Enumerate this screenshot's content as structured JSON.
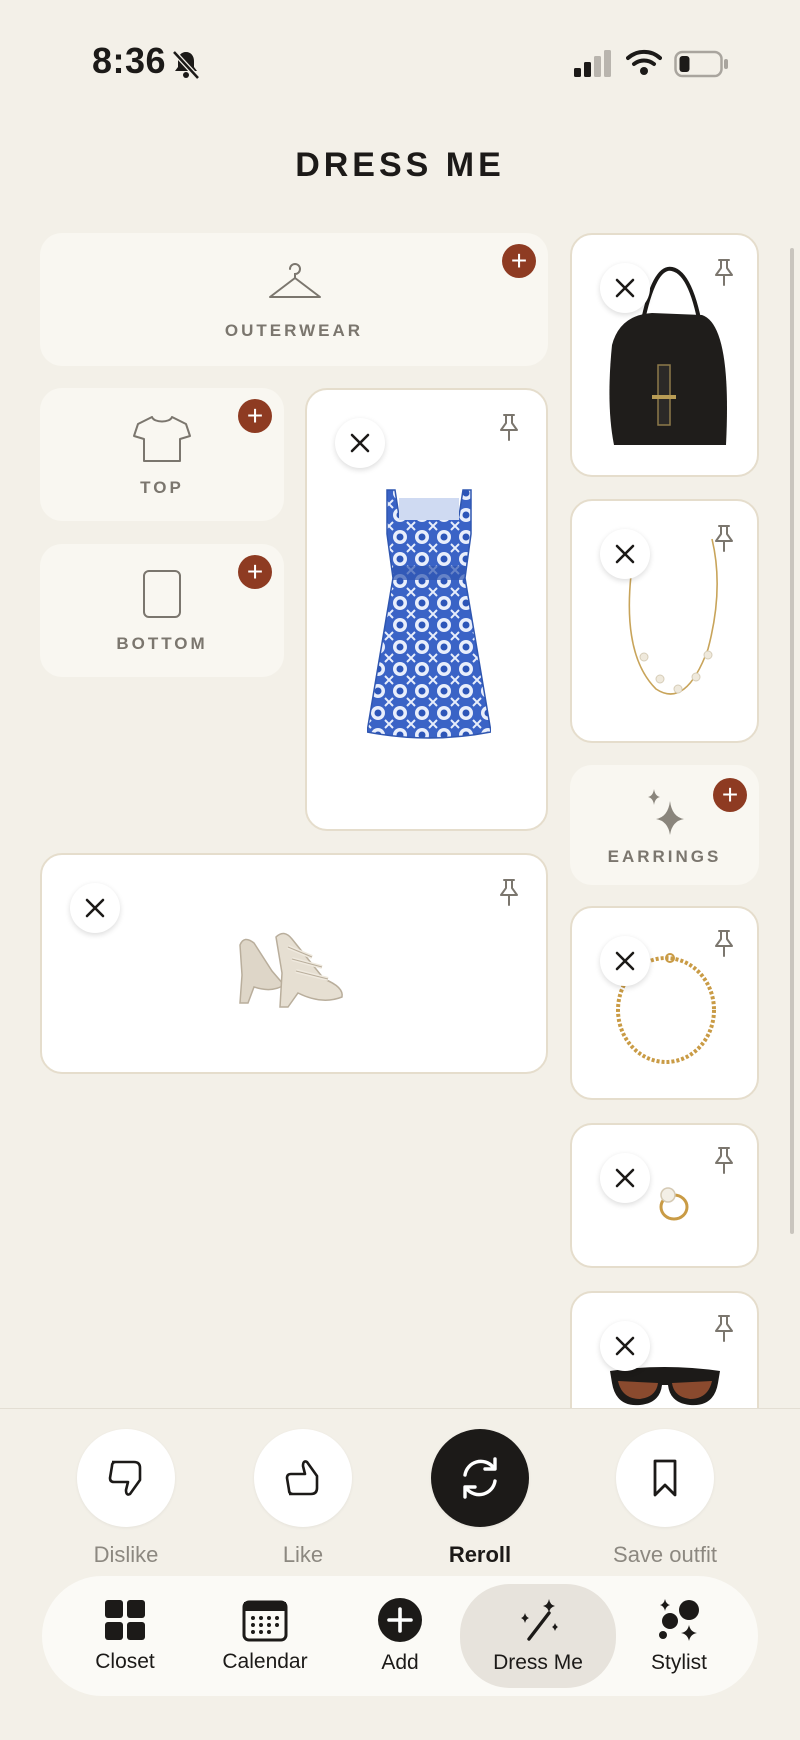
{
  "status_bar": {
    "time": "8:36"
  },
  "header": {
    "title": "DRESS ME"
  },
  "slots": {
    "outerwear": {
      "label": "OUTERWEAR"
    },
    "top": {
      "label": "TOP"
    },
    "bottom": {
      "label": "BOTTOM"
    },
    "earrings": {
      "label": "EARRINGS"
    }
  },
  "actions": {
    "dislike": "Dislike",
    "like": "Like",
    "reroll": "Reroll",
    "save": "Save outfit"
  },
  "tabs": {
    "closet": "Closet",
    "calendar": "Calendar",
    "add": "Add",
    "dress_me": "Dress Me",
    "stylist": "Stylist"
  },
  "colors": {
    "background": "#f3f0e8",
    "accent": "#8e3b22",
    "dark": "#1c1a18"
  }
}
